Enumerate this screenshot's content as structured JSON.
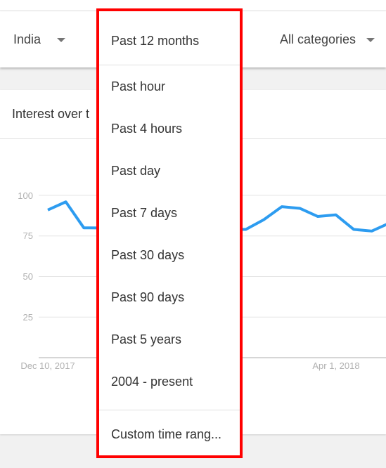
{
  "filters": {
    "region": "India",
    "category": "All categories"
  },
  "card": {
    "title": "Interest over t"
  },
  "time_dropdown": {
    "selected": "Past 12 months",
    "options": [
      "Past hour",
      "Past 4 hours",
      "Past day",
      "Past 7 days",
      "Past 30 days",
      "Past 90 days",
      "Past 5 years",
      "2004 - present"
    ],
    "custom": "Custom time rang..."
  },
  "chart_data": {
    "type": "line",
    "ylim": [
      0,
      100
    ],
    "yticks": [
      "100",
      "75",
      "50",
      "25"
    ],
    "xtick_labels": [
      "Dec 10, 2017",
      "Apr 1, 2018"
    ],
    "line_color": "#2d9cf0",
    "grid": true,
    "series": [
      {
        "points": [
          {
            "x": "2017-12-10",
            "y": 91
          },
          {
            "x": "2017-12-17",
            "y": 96
          },
          {
            "x": "2017-12-24",
            "y": 80
          },
          {
            "x": "2018-02-25",
            "y": 79
          },
          {
            "x": "2018-03-04",
            "y": 85
          },
          {
            "x": "2018-03-11",
            "y": 93
          },
          {
            "x": "2018-03-18",
            "y": 92
          },
          {
            "x": "2018-03-25",
            "y": 87
          },
          {
            "x": "2018-04-01",
            "y": 88
          },
          {
            "x": "2018-04-08",
            "y": 79
          },
          {
            "x": "2018-04-15",
            "y": 78
          },
          {
            "x": "2018-04-22",
            "y": 83
          }
        ]
      }
    ]
  }
}
